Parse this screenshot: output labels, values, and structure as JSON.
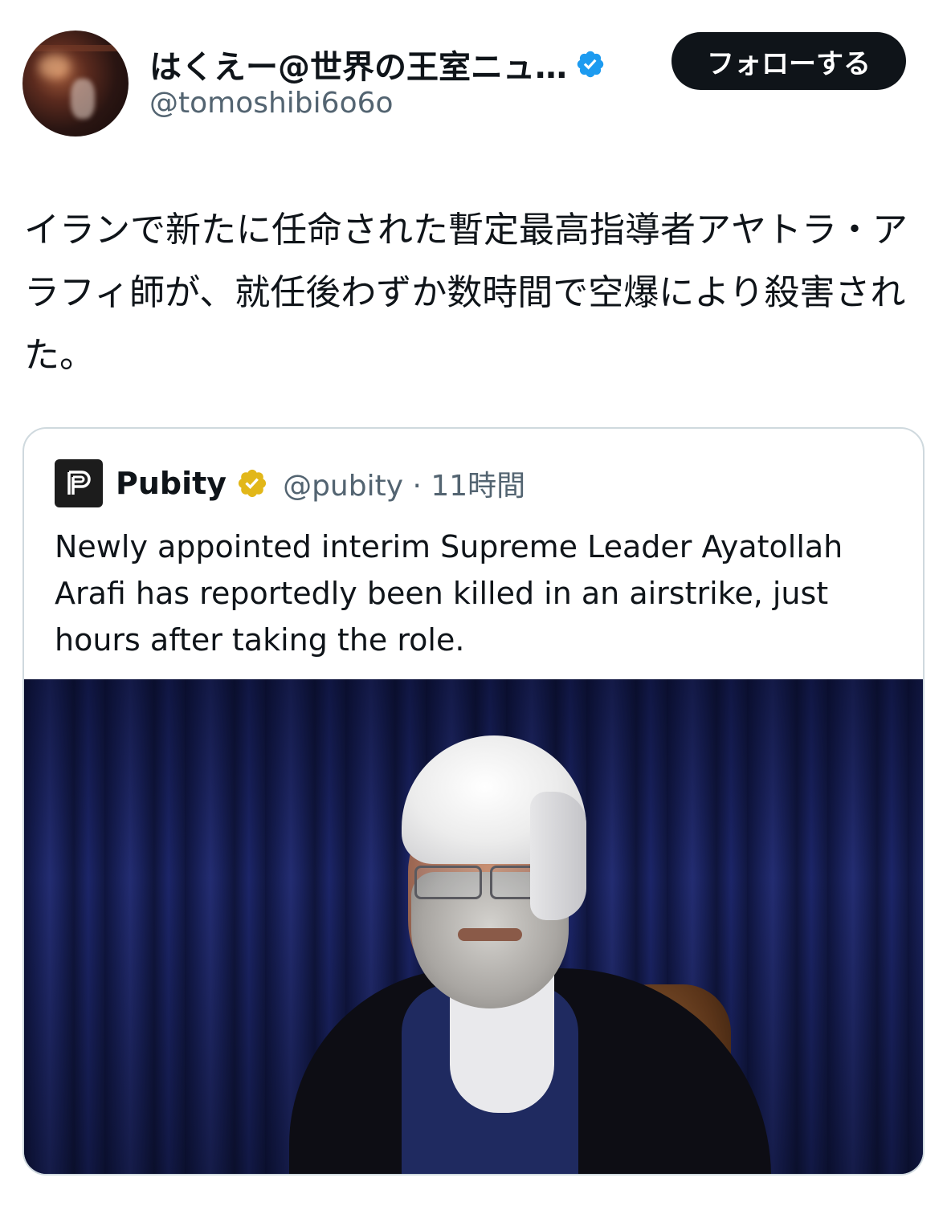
{
  "header": {
    "display_name": "はくえー@世界の王室ニュ…",
    "handle": "@tomoshibi6o6o",
    "follow_label": "フォローする",
    "verified": "blue-verified-badge-icon"
  },
  "tweet": {
    "text": "イランで新たに任命された暫定最高指導者アヤトラ・アラフィ師が、就任後わずか数時間で空爆により殺害された。"
  },
  "quote": {
    "name": "Pubity",
    "handle_time": "@pubity · 11時間",
    "verified": "gold-verified-badge-icon",
    "logo": "pubity-logo-icon",
    "text": "Newly appointed interim Supreme Leader Ayatollah Arafi has reportedly been killed in an airstrike, just hours after taking the role."
  },
  "colors": {
    "text": "#0f1419",
    "secondary": "#536471",
    "follow_bg": "#0f1419",
    "verified_blue": "#1d9bf0",
    "verified_gold": "#e2b719",
    "border": "#cfd9de"
  }
}
